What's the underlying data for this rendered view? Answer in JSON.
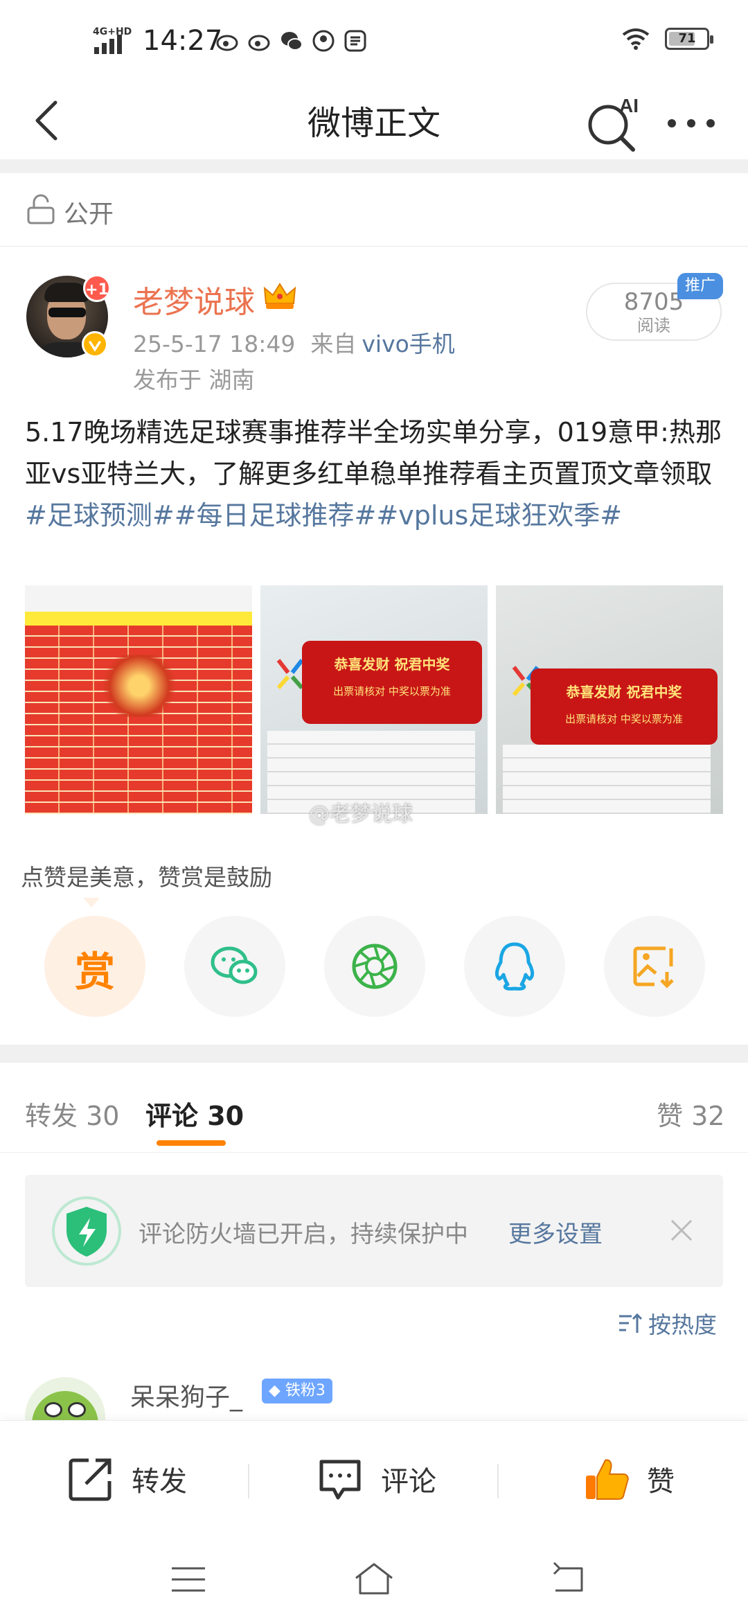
{
  "status_bar": {
    "network": "4G+HD",
    "time": "14:27",
    "battery": "71",
    "battery_level": 0.71
  },
  "nav": {
    "title": "微博正文",
    "ai_label": "AI"
  },
  "visibility": "公开",
  "author": {
    "name": "老梦说球",
    "plus_badge": "+1",
    "timestamp": "25-5-17 18:49",
    "source_prefix": "来自",
    "device": "vivo手机",
    "location": "发布于 湖南",
    "reads_count": "8705",
    "reads_label": "阅读",
    "promo_badge": "推广"
  },
  "post": {
    "text": "5.17晚场精选足球赛事推荐半全场实单分享，019意甲:热那亚vs亚特兰大，了解更多红单稳单推荐看主页置顶文章领取",
    "tags": [
      "#足球预测#",
      "#每日足球推荐#",
      "#vplus足球狂欢季#"
    ],
    "image_texts": {
      "ticket_line1": "恭喜发财 祝君中奖",
      "ticket_line2": "出票请核对 中奖以票为准"
    },
    "watermark": "@老梦说球"
  },
  "reward": {
    "prompt": "点赞是美意，赞赏是鼓励",
    "reward_char": "赏"
  },
  "tabs": {
    "repost": "转发 30",
    "comment": "评论 30",
    "like": "赞 32"
  },
  "firewall": {
    "text": "评论防火墙已开启，持续保护中",
    "link": "更多设置"
  },
  "sort_label": "按热度",
  "comment": {
    "user": "呆呆狗子_",
    "badge": "铁粉3"
  },
  "bottom_bar": {
    "repost": "转发",
    "comment": "评论",
    "like": "赞"
  },
  "colors": {
    "accent": "#ff8200",
    "link": "#56779e",
    "author": "#eb7350"
  }
}
